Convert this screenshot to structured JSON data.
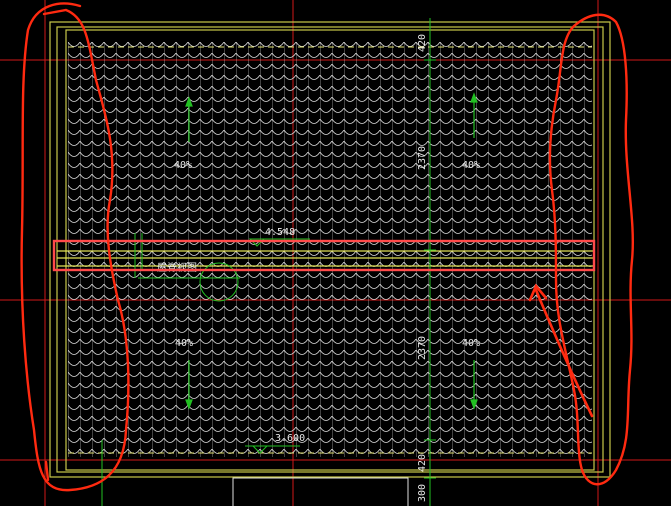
{
  "colors": {
    "background": "#000000",
    "roof_outline": "#c8c84a",
    "tile_lines": "#d8d8d8",
    "dimension": "#22c022",
    "axis": "#ff2020",
    "highlight": "#ff4a4a",
    "annotation_scribble": "#ff2a10"
  },
  "labels": {
    "slope_top_left": "40%",
    "slope_top_right": "40%",
    "slope_bottom_left": "40%",
    "slope_bottom_right": "40%",
    "ridge_elevation": "4.548",
    "ridge_name": "屋脊视图",
    "eave_elevation": "3.600",
    "dim_top_edge": "420",
    "dim_upper_span": "2370",
    "dim_lower_span": "2370",
    "dim_bottom_edge": "420",
    "dim_bottom_extra": "300"
  },
  "icons": {
    "slope_arrow": "arrow-up-icon",
    "elevation_marker": "triangle-marker-icon",
    "callout_arrow": "red-arrow-icon"
  }
}
